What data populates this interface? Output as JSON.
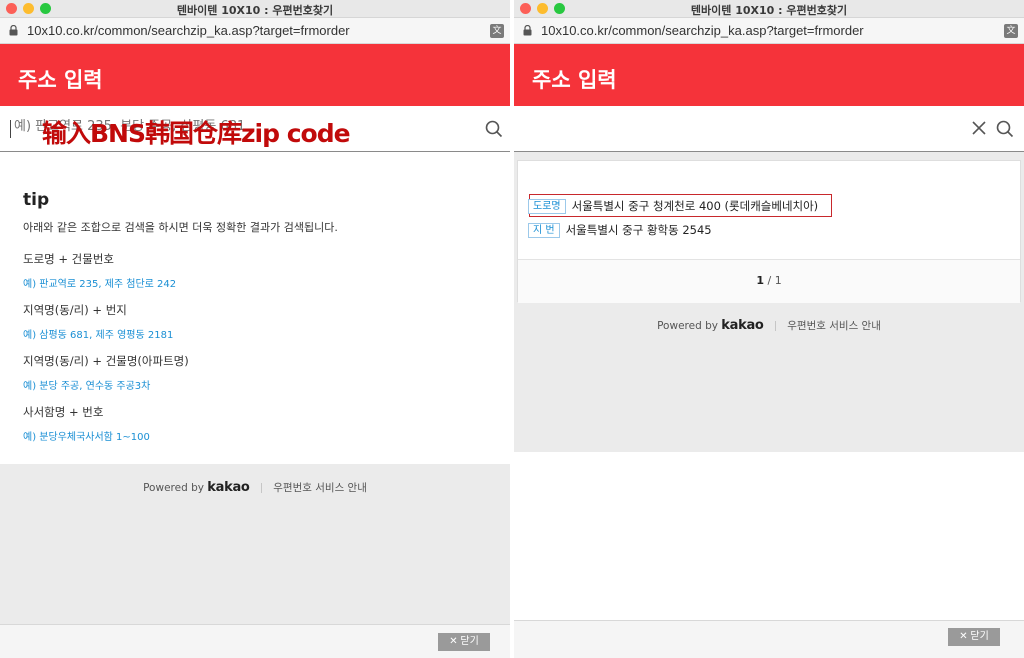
{
  "left_window": {
    "title": "텐바이텐 10X10 : 우편번호찾기",
    "url": "10x10.co.kr/common/searchzip_ka.asp?target=frmorder",
    "header_title": "주소 입력",
    "search": {
      "placeholder": "예) 판교역로 235, 분당 주공, 삼평동 681",
      "value": ""
    },
    "annotation": "输入BNS韩国仓库zip code",
    "tip": {
      "title": "tip",
      "description": "아래와 같은 조합으로 검색을 하시면 더욱 정확한 결과가 검색됩니다.",
      "items": [
        {
          "heading": "도로명 + 건물번호",
          "example": "예) 판교역로 235,  제주 첨단로 242"
        },
        {
          "heading": "지역명(동/리) + 번지",
          "example": "예) 삼평동 681,  제주 영평동 2181"
        },
        {
          "heading": "지역명(동/리) + 건물명(아파트명)",
          "example": "예) 분당 주공,  연수동 주공3차"
        },
        {
          "heading": "사서함명 + 번호",
          "example": "예) 분당우체국사서함 1~100"
        }
      ]
    },
    "powered": {
      "prefix": "Powered by",
      "brand": "kakao",
      "guide": "우편번호 서비스 안내"
    },
    "close_label": "닫기"
  },
  "right_window": {
    "title": "텐바이텐 10X10 : 우편번호찾기",
    "url": "10x10.co.kr/common/searchzip_ka.asp?target=frmorder",
    "header_title": "주소 입력",
    "search": {
      "value": ""
    },
    "results": [
      {
        "badge": "도로명",
        "address": "서울특별시 중구 청계천로 400 (롯데캐슬베네치아)"
      },
      {
        "badge": "지 번",
        "address": "서울특별시 중구 황학동 2545"
      }
    ],
    "pager": {
      "current": "1",
      "separator": "/",
      "total": "1"
    },
    "powered": {
      "prefix": "Powered by",
      "brand": "kakao",
      "guide": "우편번호 서비스 안내"
    },
    "close_label": "닫기"
  },
  "colors": {
    "header_red": "#f5333a",
    "example_blue": "#1a8fd4",
    "annotation_red": "#c10a0a"
  },
  "icons": [
    "lock-icon",
    "translate-icon",
    "search-icon",
    "clear-icon",
    "close-x-icon"
  ]
}
